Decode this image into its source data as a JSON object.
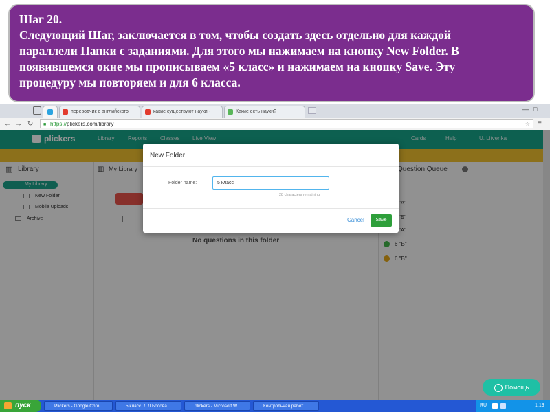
{
  "caption": {
    "lines": [
      "Шаг 20.",
      "Следующий Шаг, заключается в том, чтобы создать здесь отдельно для каждой",
      "параллели Папки с заданиями. Для этого мы нажимаем на кнопку New Folder. В",
      "появившемся окне мы прописываем «5 класс» и нажимаем на кнопку Save. Эту",
      "процедуру мы повторяем и для 6 класса."
    ]
  },
  "browser": {
    "tabs": [
      {
        "label": "переводчик с английского"
      },
      {
        "label": "какие существуют науки -"
      },
      {
        "label": "Какие есть науки?"
      }
    ],
    "url_scheme": "https://",
    "url_rest": "plickers.com/library"
  },
  "app": {
    "logo": "plickers",
    "nav": [
      "Library",
      "Reports",
      "Classes",
      "Live View"
    ],
    "nav_right": [
      "Cards",
      "Help",
      "U. Litvenka"
    ],
    "library_header": "Library",
    "my_library_header": "My Library",
    "sidebar": {
      "my_library": "My Library",
      "new_folder": "New Folder",
      "mobile_uploads": "Mobile Uploads",
      "archive": "Archive"
    },
    "empty_text": "No questions in this folder",
    "queue_header": "Question Queue",
    "queue_items": [
      {
        "label": "\"А\"",
        "color": "#22a83a"
      },
      {
        "label": "\"Б\"",
        "color": "#22a83a"
      },
      {
        "label": "\"А\"",
        "color": "#e6a817"
      },
      {
        "label": "6 \"Б\"",
        "color": "#43b649"
      },
      {
        "label": "6 \"В\"",
        "color": "#e6a817"
      }
    ],
    "help_button": "Помощь"
  },
  "modal": {
    "title": "New Folder",
    "field_label": "Folder name:",
    "field_value": "5 класс",
    "remaining": "28 characters remaining",
    "cancel": "Cancel",
    "save": "Save"
  },
  "taskbar": {
    "start": "пуск",
    "tasks": [
      "Plickers - Google Chro...",
      "5 класс. Л.Л.Босова....",
      "plickers - Microsoft W...",
      "Контрольная работ..."
    ],
    "lang": "RU",
    "time": "1:19"
  },
  "colors": {
    "caption_bg": "#7b2d8e",
    "appbar": "#17a58a",
    "banner": "#f2c230",
    "save": "#2e9f3b",
    "taskbar": "#2458d4"
  }
}
